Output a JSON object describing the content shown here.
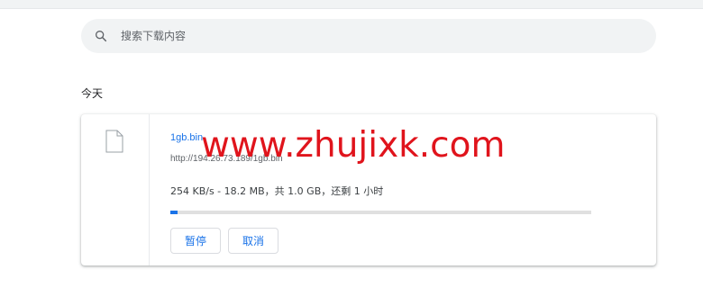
{
  "search": {
    "placeholder": "搜索下载内容",
    "icon": "search-icon"
  },
  "section": {
    "title": "今天"
  },
  "download": {
    "file_name": "1gb.bin",
    "url": "http://194.26.73.189/1gb.bin",
    "status": "254 KB/s - 18.2 MB，共 1.0 GB，还剩 1 小时",
    "progress_fraction": 0.018,
    "pause_label": "暂停",
    "cancel_label": "取消"
  },
  "watermark": {
    "text": "www.zhujixk.com"
  },
  "colors": {
    "accent": "#1a73e8",
    "watermark": "#e0141c"
  }
}
